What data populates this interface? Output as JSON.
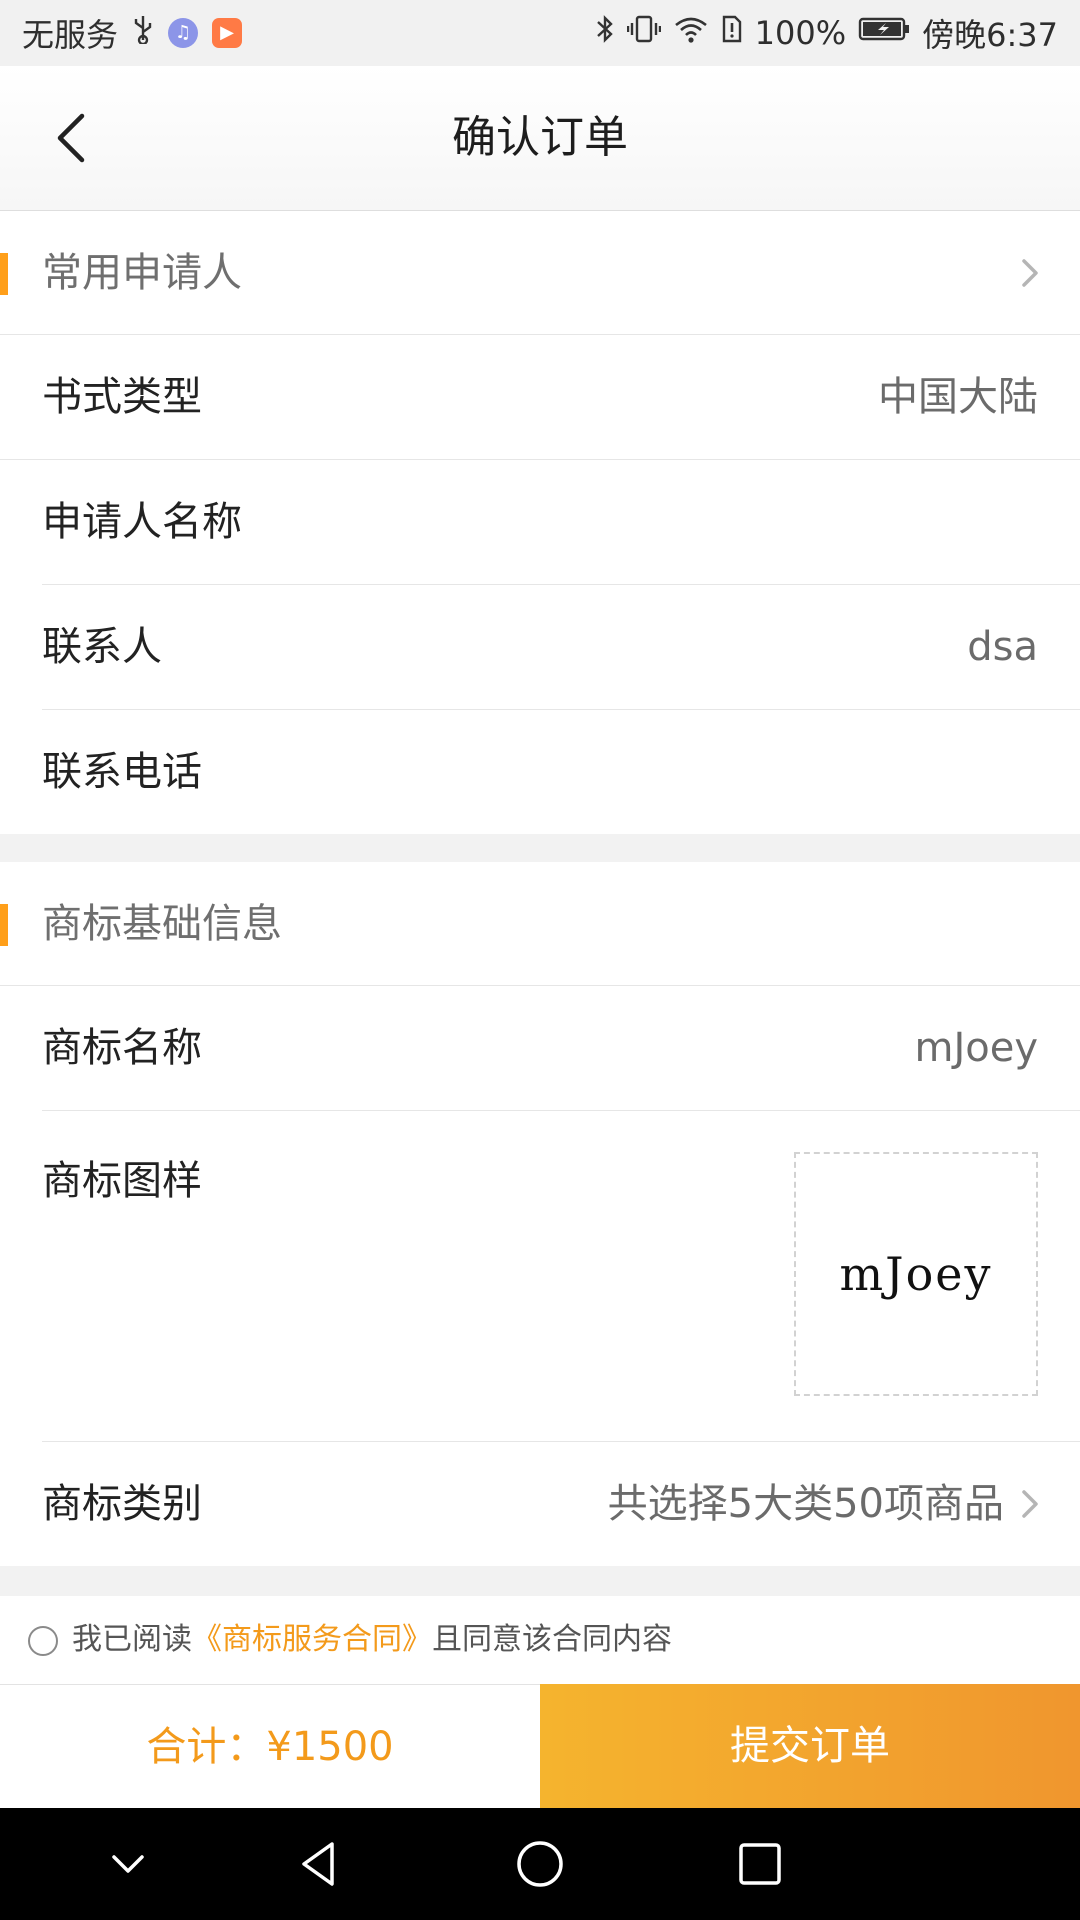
{
  "status_bar": {
    "carrier": "无服务",
    "battery": "100%",
    "time": "傍晚6:37"
  },
  "header": {
    "title": "确认订单"
  },
  "applicant_section": {
    "title": "常用申请人"
  },
  "fields": {
    "document_type": {
      "label": "书式类型",
      "value": "中国大陆"
    },
    "applicant_name": {
      "label": "申请人名称",
      "value": ""
    },
    "contact_person": {
      "label": "联系人",
      "value": "dsa"
    },
    "contact_phone": {
      "label": "联系电话",
      "value": ""
    }
  },
  "trademark_section": {
    "title": "商标基础信息",
    "name_label": "商标名称",
    "name_value": "mJoey",
    "sample_label": "商标图样",
    "sample_text": "mJoey",
    "category_label": "商标类别",
    "category_value": "共选择5大类50项商品"
  },
  "agreement": {
    "prefix": "我已阅读",
    "link": "《商标服务合同》",
    "suffix": "且同意该合同内容",
    "checked": false
  },
  "footer": {
    "total": "合计：¥1500",
    "submit": "提交订单"
  },
  "colors": {
    "accent": "#ff9f1a",
    "price": "#f39a1b",
    "submit_start": "#f5b42e",
    "submit_end": "#f0962e"
  },
  "icons": {
    "back": "chevron-left-icon",
    "row_arrow": "chevron-right-icon",
    "nav": [
      "chevron-down-icon",
      "back-triangle-icon",
      "home-circle-icon",
      "recent-square-icon"
    ]
  }
}
